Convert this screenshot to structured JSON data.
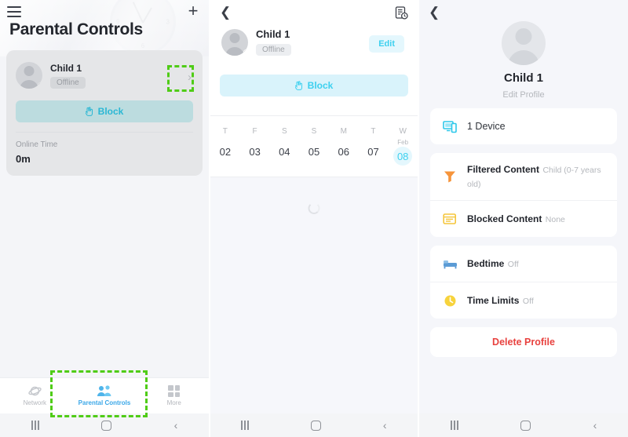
{
  "panel1": {
    "header": {
      "menu_icon": "hamburger-icon",
      "add_icon": "plus-icon",
      "title": "Parental Controls",
      "decor_icon": "wall-clock-decoration"
    },
    "child_card": {
      "avatar_icon": "avatar-placeholder",
      "name": "Child 1",
      "status": "Offline",
      "chevron_icon": "chevron-right-icon",
      "block_icon": "hand-block-icon",
      "block_label": "Block",
      "online_time_label": "Online Time",
      "online_time_value": "0m"
    },
    "tabbar": [
      {
        "label": "Network",
        "icon": "network-icon",
        "active": false
      },
      {
        "label": "Parental Controls",
        "icon": "people-icon",
        "active": true
      },
      {
        "label": "More",
        "icon": "grid-more-icon",
        "active": false
      }
    ]
  },
  "panel2": {
    "back_icon": "chevron-left-icon",
    "report_icon": "document-clock-icon",
    "name": "Child 1",
    "status": "Offline",
    "edit_label": "Edit",
    "block_icon": "hand-block-icon",
    "block_label": "Block",
    "dates": [
      {
        "dow": "T",
        "month": "",
        "num": "02",
        "selected": false
      },
      {
        "dow": "F",
        "month": "",
        "num": "03",
        "selected": false
      },
      {
        "dow": "S",
        "month": "",
        "num": "04",
        "selected": false
      },
      {
        "dow": "S",
        "month": "",
        "num": "05",
        "selected": false
      },
      {
        "dow": "M",
        "month": "",
        "num": "06",
        "selected": false
      },
      {
        "dow": "T",
        "month": "",
        "num": "07",
        "selected": false
      },
      {
        "dow": "W",
        "month": "Feb",
        "num": "08",
        "selected": true
      }
    ],
    "loading_icon": "loading-spinner"
  },
  "panel3": {
    "back_icon": "chevron-left-icon",
    "avatar_icon": "avatar-placeholder",
    "name": "Child 1",
    "edit_profile_label": "Edit Profile",
    "device_item": {
      "icon": "devices-icon",
      "label": "1 Device"
    },
    "content_items": [
      {
        "icon": "filter-funnel-icon",
        "title": "Filtered Content",
        "subtitle": "Child (0-7 years old)"
      },
      {
        "icon": "blocked-window-icon",
        "title": "Blocked Content",
        "subtitle": "None"
      }
    ],
    "schedule_items": [
      {
        "icon": "bed-icon",
        "title": "Bedtime",
        "subtitle": "Off"
      },
      {
        "icon": "clock-icon",
        "title": "Time Limits",
        "subtitle": "Off"
      }
    ],
    "delete_label": "Delete Profile"
  },
  "navbar": {
    "recent_icon": "recent-apps-icon",
    "home_icon": "home-icon",
    "back_icon": "back-icon"
  },
  "colors": {
    "accent_cyan": "#3dd0ef",
    "accent_blue": "#3aa7e8",
    "highlight_green": "#4fcc16",
    "danger_red": "#e8423f",
    "funnel_orange": "#f6943b",
    "window_yellow": "#f5c63c",
    "bed_blue": "#5b9bd5",
    "clock_yellow": "#f7d33c"
  }
}
